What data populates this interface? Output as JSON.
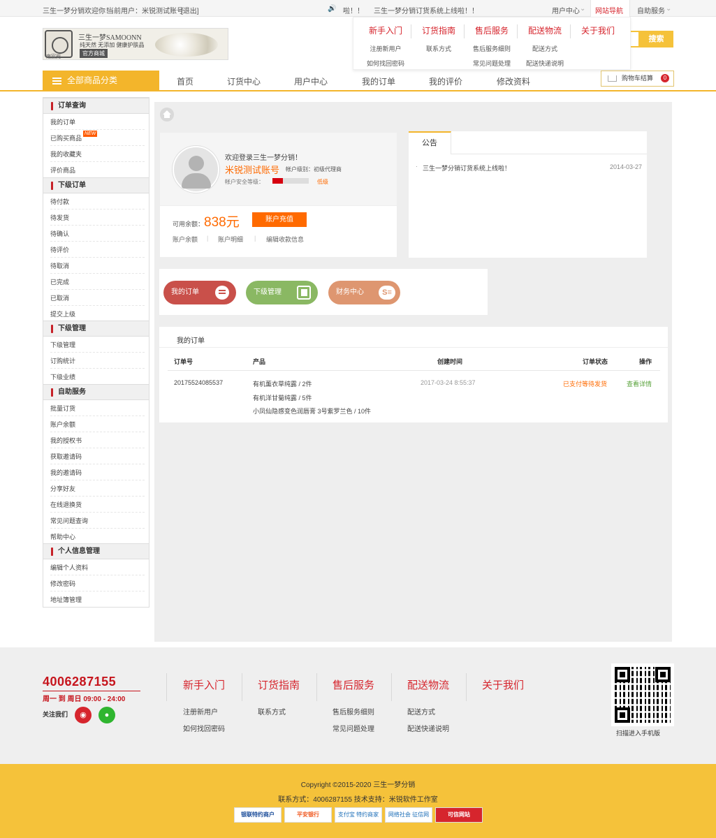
{
  "topbar": {
    "welcome": "三生一梦分销欢迎你！",
    "current_user_label": "当前用户：米锐测试账号",
    "logout": "[退出]",
    "notice_prefix": "啦！！",
    "notice_text": "三生一梦分销订货系统上线啦！！",
    "user_center": "用户中心",
    "site_nav": "网站导航",
    "self_service": "自助服务"
  },
  "logo": {
    "brand": "三生一梦SAMOONN",
    "slogan": "纯天然 无添加 健康护肤品",
    "badge": "官方商城",
    "under": "雍宸兜"
  },
  "dropdown_nav": [
    {
      "title": "新手入门",
      "links": [
        "注册新用户",
        "如何找回密码"
      ]
    },
    {
      "title": "订货指南",
      "links": [
        "联系方式"
      ]
    },
    {
      "title": "售后服务",
      "links": [
        "售后服务细则",
        "常见问题处理"
      ]
    },
    {
      "title": "配送物流",
      "links": [
        "配送方式",
        "配送快递说明"
      ]
    },
    {
      "title": "关于我们",
      "links": []
    }
  ],
  "search": {
    "button": "搜索"
  },
  "nav": {
    "all_categories": "全部商品分类",
    "items": [
      "首页",
      "订货中心",
      "用户中心",
      "我的订单",
      "我的评价",
      "修改资料"
    ],
    "cart_label": "购物车结算",
    "cart_count": "0"
  },
  "sidebar": {
    "sections": [
      {
        "title": "订单查询",
        "items": [
          "我的订单",
          "已购买商品",
          "我的收藏夹",
          "评价商品"
        ]
      },
      {
        "title": "下级订单",
        "items": [
          "待付款",
          "待发货",
          "待确认",
          "待评价",
          "待取消",
          "已完成",
          "已取消",
          "提交上级"
        ]
      },
      {
        "title": "下级管理",
        "items": [
          "下级管理",
          "订购统计",
          "下级业绩"
        ]
      },
      {
        "title": "自助服务",
        "items": [
          "批量订货",
          "账户余额",
          "我的授权书",
          "获取邀请码",
          "我的邀请码",
          "分享好友",
          "在线退换货",
          "常见问题查询",
          "帮助中心"
        ]
      },
      {
        "title": "个人信息管理",
        "items": [
          "编辑个人资料",
          "修改密码",
          "地址簿管理"
        ]
      }
    ],
    "new_tag": "NEW"
  },
  "account": {
    "welcome": "欢迎登录三生一梦分销！",
    "username": "米锐测试账号",
    "level_label": "帐户级别：初级代理商",
    "security_label": "帐户安全等级：",
    "security_value": "低级",
    "balance_label": "可用余额：",
    "balance_value": "838元",
    "recharge": "账户充值",
    "links": [
      "账户余额",
      "账户明细",
      "编辑收款信息"
    ]
  },
  "announcement": {
    "tab": "公告",
    "items": [
      {
        "text": "三生一梦分销订货系统上线啦！",
        "date": "2014-03-27"
      }
    ]
  },
  "quick": [
    {
      "label": "我的订单",
      "color": "#c9504a",
      "icon": "list-icon"
    },
    {
      "label": "下级管理",
      "color": "#8ab863",
      "icon": "cursor-icon"
    },
    {
      "label": "财务中心",
      "color": "#de9670",
      "icon": "money-icon"
    }
  ],
  "orders": {
    "title": "我的订单",
    "headers": [
      "订单号",
      "产品",
      "创建时间",
      "订单状态",
      "操作"
    ],
    "rows": [
      {
        "id": "20175524085537",
        "products": [
          "有机薰衣草纯露 / 2件",
          "有机洋甘菊纯露 / 5件",
          "小凤仙隐感变色润唇膏 3号紫罗兰色 / 10件"
        ],
        "time": "2017-03-24 8:55:37",
        "status": "已支付等待发货",
        "action": "查看详情"
      }
    ]
  },
  "footer": {
    "phone": "4006287155",
    "hours": "周一 到 周日  09:00 - 24:00",
    "follow": "关注我们",
    "columns": [
      {
        "title": "新手入门",
        "links": [
          "注册新用户",
          "如何找回密码"
        ]
      },
      {
        "title": "订货指南",
        "links": [
          "联系方式"
        ]
      },
      {
        "title": "售后服务",
        "links": [
          "售后服务细则",
          "常见问题处理"
        ]
      },
      {
        "title": "配送物流",
        "links": [
          "配送方式",
          "配送快递说明"
        ]
      },
      {
        "title": "关于我们",
        "links": []
      }
    ],
    "qr_caption": "扫描进入手机版",
    "copyright": "Copyright ©2015-2020 三生一梦分销",
    "contact": "联系方式：4006287155 技术支持：米锐软件工作室",
    "certs": [
      "银联特约商户",
      "平安银行",
      "支付宝 特约商家",
      "网络社会 征信网",
      "可信网站"
    ]
  }
}
